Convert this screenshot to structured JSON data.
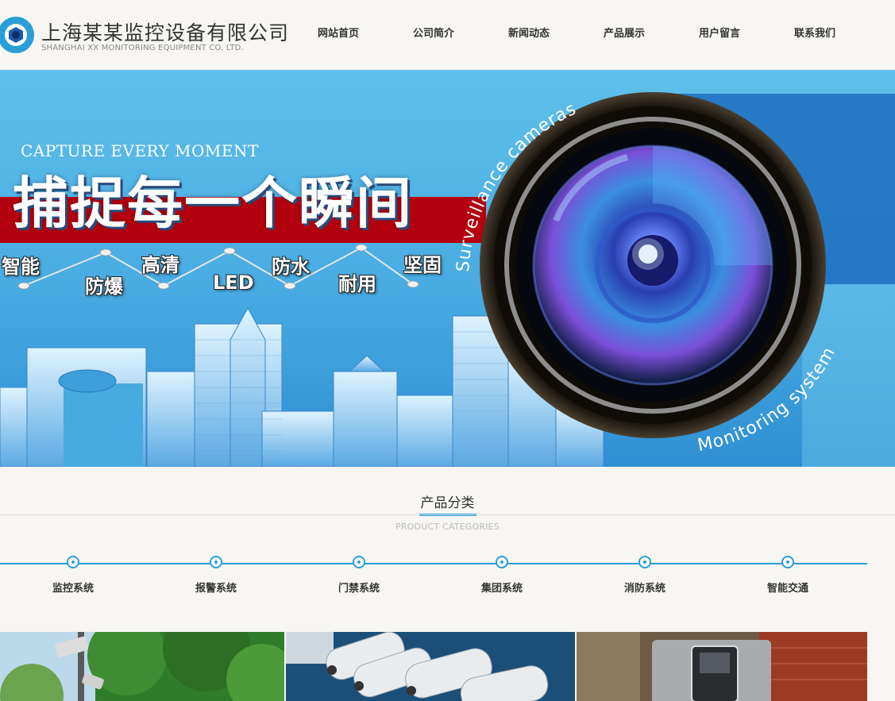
{
  "header": {
    "logo_cn": "上海某某监控设备有限公司",
    "logo_en": "SHANGHAI XX MONITORING EQUIPMENT CO. LTD.",
    "nav": [
      "网站首页",
      "公司简介",
      "新闻动态",
      "产品展示",
      "用户留言",
      "联系我们"
    ]
  },
  "banner": {
    "en_title": "CAPTURE EVERY MOMENT",
    "cn_title": "捕捉每一个瞬间",
    "features": [
      "智能",
      "防爆",
      "高清",
      "LED",
      "防水",
      "耐用",
      "坚固"
    ],
    "arc_top": "Surveillance cameras",
    "arc_bottom": "Monitoring system"
  },
  "categories": {
    "title": "产品分类",
    "subtitle": "PRODUCT CATEGORIES",
    "items": [
      "监控系统",
      "报警系统",
      "门禁系统",
      "集团系统",
      "消防系统",
      "智能交通"
    ]
  },
  "colors": {
    "accent": "#2a9ed6",
    "banner_red": "#b3000e",
    "page_bg": "#f7f6f2"
  }
}
